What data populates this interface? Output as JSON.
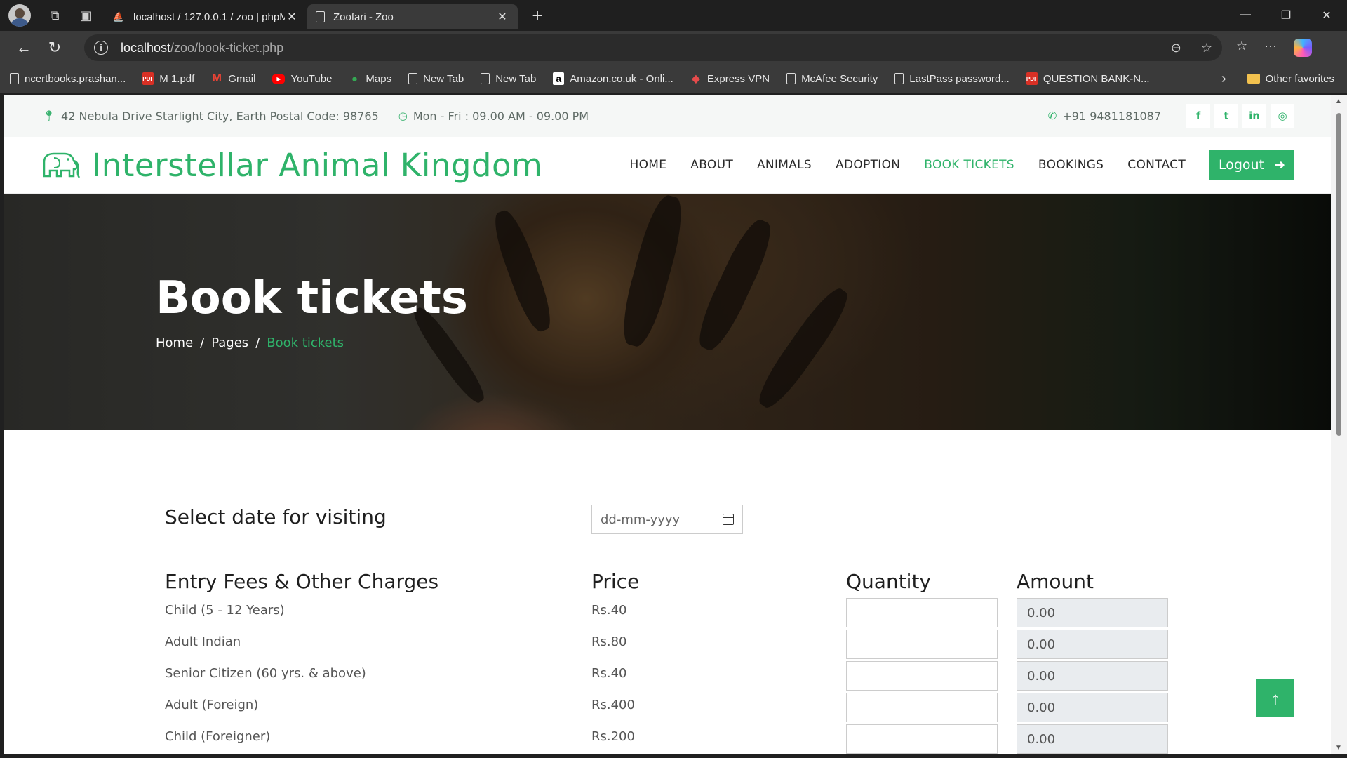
{
  "browser": {
    "tabs": [
      {
        "title": "localhost / 127.0.0.1 / zoo | phpMyAdmin",
        "active": false
      },
      {
        "title": "Zoofari - Zoo",
        "active": true
      }
    ],
    "url_host": "localhost",
    "url_path": "/zoo/book-ticket.php",
    "bookmarks": [
      {
        "label": "ncertbooks.prashan...",
        "icon": "doc"
      },
      {
        "label": "M 1.pdf",
        "icon": "pdf"
      },
      {
        "label": "Gmail",
        "icon": "gmail"
      },
      {
        "label": "YouTube",
        "icon": "youtube"
      },
      {
        "label": "Maps",
        "icon": "maps"
      },
      {
        "label": "New Tab",
        "icon": "doc"
      },
      {
        "label": "New Tab",
        "icon": "doc"
      },
      {
        "label": "Amazon.co.uk - Onli...",
        "icon": "amazon"
      },
      {
        "label": "Express VPN",
        "icon": "vpn"
      },
      {
        "label": "McAfee Security",
        "icon": "doc"
      },
      {
        "label": "LastPass password...",
        "icon": "doc"
      },
      {
        "label": "QUESTION BANK-N...",
        "icon": "pdf"
      }
    ],
    "other_favorites": "Other favorites"
  },
  "topbar": {
    "address": "42 Nebula Drive Starlight City, Earth Postal Code: 98765",
    "hours": "Mon - Fri : 09.00 AM - 09.00 PM",
    "phone": "+91 9481181087"
  },
  "brand": "Interstellar Animal Kingdom",
  "nav": {
    "items": [
      "HOME",
      "ABOUT",
      "ANIMALS",
      "ADOPTION",
      "BOOK TICKETS",
      "BOOKINGS",
      "CONTACT"
    ],
    "active": "BOOK TICKETS",
    "logout": "Logout"
  },
  "hero": {
    "title": "Book tickets",
    "crumbs": [
      "Home",
      "Pages",
      "Book tickets"
    ],
    "separator": "/"
  },
  "form": {
    "date_label": "Select date for visiting",
    "date_placeholder": "dd-mm-yyyy",
    "headers": [
      "Entry Fees & Other Charges",
      "Price",
      "Quantity",
      "Amount"
    ],
    "rows": [
      {
        "label": "Child (5 - 12 Years)",
        "price": "Rs.40",
        "amount": "0.00"
      },
      {
        "label": "Adult Indian",
        "price": "Rs.80",
        "amount": "0.00"
      },
      {
        "label": "Senior Citizen (60 yrs. & above)",
        "price": "Rs.40",
        "amount": "0.00"
      },
      {
        "label": "Adult (Foreign)",
        "price": "Rs.400",
        "amount": "0.00"
      },
      {
        "label": "Child (Foreigner)",
        "price": "Rs.200",
        "amount": "0.00"
      }
    ]
  },
  "colors": {
    "accent": "#2fb36a"
  }
}
